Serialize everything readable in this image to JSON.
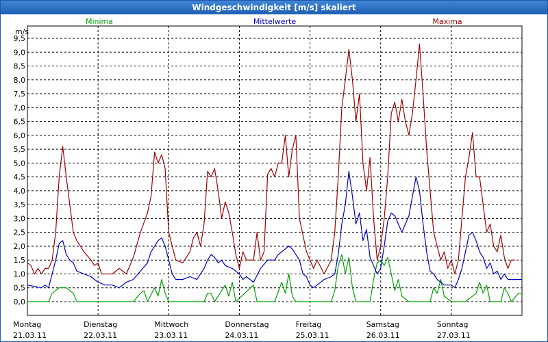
{
  "window": {
    "title": "Windgeschwindigkeit [m/s] skaliert"
  },
  "colors": {
    "minima": "#00a000",
    "mittel": "#0000c0",
    "maxima": "#a00000",
    "grid": "#000000"
  },
  "chart_data": {
    "type": "line",
    "title": "Windgeschwindigkeit [m/s] skaliert",
    "ylabel": "m/s",
    "xlabel": "",
    "ylim": [
      0,
      9.5
    ],
    "yticks": [
      "0,0",
      "0,5",
      "1,0",
      "1,5",
      "2,0",
      "2,5",
      "3,0",
      "3,5",
      "4,0",
      "4,5",
      "5,0",
      "5,5",
      "6,0",
      "6,5",
      "7,0",
      "7,5",
      "8,0",
      "8,5",
      "9,0",
      "9,5"
    ],
    "xticks": [
      {
        "day": "Montag",
        "date": "21.03.11"
      },
      {
        "day": "Dienstag",
        "date": "22.03.11"
      },
      {
        "day": "Mittwoch",
        "date": "23.03.11"
      },
      {
        "day": "Donnerstag",
        "date": "24.03.11"
      },
      {
        "day": "Freitag",
        "date": "25.03.11"
      },
      {
        "day": "Samstag",
        "date": "26.03.11"
      },
      {
        "day": "Sonntag",
        "date": "27.03.11"
      }
    ],
    "x_unit": "days since Montag 21.03.11 00:00",
    "x_range": [
      0,
      7
    ],
    "grid": true,
    "series": [
      {
        "name": "Minima",
        "color": "#00a000",
        "points": [
          [
            0,
            0
          ],
          [
            0.3,
            0
          ],
          [
            0.35,
            0.3
          ],
          [
            0.45,
            0.5
          ],
          [
            0.55,
            0.5
          ],
          [
            0.65,
            0.3
          ],
          [
            0.7,
            0
          ],
          [
            1.0,
            0
          ],
          [
            1.2,
            0
          ],
          [
            1.5,
            0
          ],
          [
            1.6,
            0.3
          ],
          [
            1.65,
            0.4
          ],
          [
            1.7,
            0
          ],
          [
            1.8,
            0.5
          ],
          [
            1.85,
            0.2
          ],
          [
            1.9,
            0.8
          ],
          [
            1.95,
            0.3
          ],
          [
            2.0,
            0
          ],
          [
            2.2,
            0
          ],
          [
            2.5,
            0
          ],
          [
            2.55,
            0.3
          ],
          [
            2.6,
            0.3
          ],
          [
            2.65,
            0
          ],
          [
            2.8,
            0.6
          ],
          [
            2.85,
            0.2
          ],
          [
            2.9,
            0.7
          ],
          [
            2.95,
            0
          ],
          [
            3.2,
            0.6
          ],
          [
            3.25,
            0
          ],
          [
            3.5,
            0
          ],
          [
            3.6,
            0.7
          ],
          [
            3.65,
            0.3
          ],
          [
            3.7,
            1.0
          ],
          [
            3.75,
            0.2
          ],
          [
            3.8,
            0
          ],
          [
            4.3,
            0
          ],
          [
            4.35,
            0.4
          ],
          [
            4.4,
            1.3
          ],
          [
            4.45,
            1.7
          ],
          [
            4.5,
            1.0
          ],
          [
            4.55,
            1.6
          ],
          [
            4.6,
            0.5
          ],
          [
            4.65,
            0
          ],
          [
            4.85,
            0
          ],
          [
            4.9,
            0.8
          ],
          [
            4.95,
            1.4
          ],
          [
            5.0,
            1.5
          ],
          [
            5.05,
            1.3
          ],
          [
            5.1,
            1.6
          ],
          [
            5.15,
            1.0
          ],
          [
            5.2,
            0.4
          ],
          [
            5.25,
            0.8
          ],
          [
            5.3,
            0.2
          ],
          [
            5.4,
            0
          ],
          [
            5.7,
            0
          ],
          [
            5.75,
            0.5
          ],
          [
            5.8,
            0.3
          ],
          [
            5.85,
            0.8
          ],
          [
            5.9,
            0.2
          ],
          [
            6.0,
            0
          ],
          [
            6.2,
            0
          ],
          [
            6.35,
            0.3
          ],
          [
            6.4,
            0.7
          ],
          [
            6.45,
            0.3
          ],
          [
            6.5,
            0.6
          ],
          [
            6.55,
            0
          ],
          [
            6.7,
            0
          ],
          [
            6.75,
            0.5
          ],
          [
            6.8,
            0.3
          ],
          [
            6.85,
            0
          ],
          [
            6.95,
            0.3
          ],
          [
            7.0,
            0.3
          ]
        ]
      },
      {
        "name": "Mittelwerte",
        "color": "#0000c0",
        "points": [
          [
            0,
            0.6
          ],
          [
            0.1,
            0.55
          ],
          [
            0.2,
            0.5
          ],
          [
            0.25,
            0.6
          ],
          [
            0.3,
            0.5
          ],
          [
            0.35,
            1.0
          ],
          [
            0.4,
            1.5
          ],
          [
            0.45,
            2.1
          ],
          [
            0.5,
            2.2
          ],
          [
            0.55,
            1.7
          ],
          [
            0.6,
            1.5
          ],
          [
            0.65,
            1.4
          ],
          [
            0.7,
            1.1
          ],
          [
            0.8,
            1.0
          ],
          [
            0.9,
            0.9
          ],
          [
            1.0,
            0.7
          ],
          [
            1.1,
            0.6
          ],
          [
            1.2,
            0.6
          ],
          [
            1.3,
            0.5
          ],
          [
            1.4,
            0.7
          ],
          [
            1.5,
            0.8
          ],
          [
            1.6,
            1.1
          ],
          [
            1.7,
            1.4
          ],
          [
            1.75,
            1.8
          ],
          [
            1.8,
            2.0
          ],
          [
            1.85,
            2.2
          ],
          [
            1.9,
            2.3
          ],
          [
            1.95,
            2.0
          ],
          [
            2.0,
            1.5
          ],
          [
            2.05,
            1.0
          ],
          [
            2.1,
            0.8
          ],
          [
            2.2,
            0.8
          ],
          [
            2.3,
            0.9
          ],
          [
            2.4,
            0.8
          ],
          [
            2.45,
            1.0
          ],
          [
            2.5,
            1.2
          ],
          [
            2.55,
            1.5
          ],
          [
            2.6,
            1.7
          ],
          [
            2.65,
            1.6
          ],
          [
            2.7,
            1.4
          ],
          [
            2.75,
            1.5
          ],
          [
            2.8,
            1.3
          ],
          [
            2.9,
            1.2
          ],
          [
            3.0,
            1.0
          ],
          [
            3.05,
            0.8
          ],
          [
            3.1,
            0.9
          ],
          [
            3.2,
            0.7
          ],
          [
            3.3,
            1.2
          ],
          [
            3.4,
            1.5
          ],
          [
            3.5,
            1.5
          ],
          [
            3.55,
            1.7
          ],
          [
            3.6,
            1.8
          ],
          [
            3.65,
            1.9
          ],
          [
            3.7,
            2.0
          ],
          [
            3.75,
            1.9
          ],
          [
            3.8,
            1.7
          ],
          [
            3.85,
            1.5
          ],
          [
            3.9,
            1.0
          ],
          [
            3.95,
            0.9
          ],
          [
            4.0,
            0.6
          ],
          [
            4.05,
            0.5
          ],
          [
            4.1,
            0.6
          ],
          [
            4.2,
            0.8
          ],
          [
            4.3,
            0.9
          ],
          [
            4.35,
            1.0
          ],
          [
            4.4,
            1.7
          ],
          [
            4.45,
            2.8
          ],
          [
            4.5,
            3.5
          ],
          [
            4.55,
            4.7
          ],
          [
            4.6,
            3.8
          ],
          [
            4.65,
            2.8
          ],
          [
            4.7,
            3.2
          ],
          [
            4.75,
            2.2
          ],
          [
            4.8,
            2.6
          ],
          [
            4.85,
            1.6
          ],
          [
            4.9,
            1.3
          ],
          [
            4.95,
            1.0
          ],
          [
            5.0,
            1.2
          ],
          [
            5.05,
            2.0
          ],
          [
            5.1,
            2.9
          ],
          [
            5.15,
            3.2
          ],
          [
            5.2,
            3.1
          ],
          [
            5.25,
            2.8
          ],
          [
            5.3,
            2.5
          ],
          [
            5.35,
            2.8
          ],
          [
            5.4,
            3.1
          ],
          [
            5.45,
            3.8
          ],
          [
            5.5,
            4.5
          ],
          [
            5.55,
            4.0
          ],
          [
            5.6,
            2.8
          ],
          [
            5.65,
            1.8
          ],
          [
            5.7,
            1.1
          ],
          [
            5.75,
            1.0
          ],
          [
            5.8,
            0.8
          ],
          [
            5.85,
            0.7
          ],
          [
            5.9,
            0.6
          ],
          [
            6.0,
            0.6
          ],
          [
            6.05,
            0.5
          ],
          [
            6.1,
            0.8
          ],
          [
            6.15,
            1.2
          ],
          [
            6.2,
            1.8
          ],
          [
            6.25,
            2.4
          ],
          [
            6.3,
            2.5
          ],
          [
            6.35,
            2.2
          ],
          [
            6.4,
            1.8
          ],
          [
            6.45,
            1.6
          ],
          [
            6.5,
            1.2
          ],
          [
            6.55,
            1.4
          ],
          [
            6.6,
            1.0
          ],
          [
            6.65,
            1.1
          ],
          [
            6.7,
            0.8
          ],
          [
            6.75,
            1.0
          ],
          [
            6.8,
            0.8
          ],
          [
            6.9,
            0.8
          ],
          [
            7.0,
            0.8
          ]
        ]
      },
      {
        "name": "Maxima",
        "color": "#a00000",
        "points": [
          [
            0,
            1.4
          ],
          [
            0.05,
            1.3
          ],
          [
            0.1,
            1.0
          ],
          [
            0.15,
            1.2
          ],
          [
            0.2,
            1.0
          ],
          [
            0.25,
            1.2
          ],
          [
            0.3,
            1.2
          ],
          [
            0.35,
            1.5
          ],
          [
            0.4,
            2.5
          ],
          [
            0.45,
            4.5
          ],
          [
            0.5,
            5.6
          ],
          [
            0.55,
            4.5
          ],
          [
            0.6,
            3.5
          ],
          [
            0.65,
            2.5
          ],
          [
            0.7,
            2.2
          ],
          [
            0.8,
            1.8
          ],
          [
            0.9,
            1.5
          ],
          [
            0.95,
            1.3
          ],
          [
            1.0,
            1.4
          ],
          [
            1.05,
            1.0
          ],
          [
            1.1,
            1.0
          ],
          [
            1.2,
            1.0
          ],
          [
            1.3,
            1.2
          ],
          [
            1.4,
            1.0
          ],
          [
            1.5,
            1.6
          ],
          [
            1.6,
            2.5
          ],
          [
            1.7,
            3.2
          ],
          [
            1.75,
            3.8
          ],
          [
            1.8,
            5.4
          ],
          [
            1.85,
            5.0
          ],
          [
            1.9,
            5.3
          ],
          [
            1.95,
            4.8
          ],
          [
            2.0,
            2.5
          ],
          [
            2.05,
            2.0
          ],
          [
            2.1,
            1.5
          ],
          [
            2.2,
            1.4
          ],
          [
            2.3,
            1.8
          ],
          [
            2.35,
            2.3
          ],
          [
            2.4,
            2.5
          ],
          [
            2.45,
            2.0
          ],
          [
            2.5,
            2.8
          ],
          [
            2.55,
            4.7
          ],
          [
            2.6,
            4.5
          ],
          [
            2.65,
            4.8
          ],
          [
            2.7,
            4.0
          ],
          [
            2.75,
            3.0
          ],
          [
            2.8,
            3.6
          ],
          [
            2.85,
            3.2
          ],
          [
            2.9,
            2.5
          ],
          [
            2.95,
            1.7
          ],
          [
            3.0,
            1.2
          ],
          [
            3.05,
            1.8
          ],
          [
            3.1,
            1.5
          ],
          [
            3.2,
            1.5
          ],
          [
            3.25,
            2.5
          ],
          [
            3.3,
            1.5
          ],
          [
            3.35,
            1.8
          ],
          [
            3.4,
            4.6
          ],
          [
            3.45,
            4.8
          ],
          [
            3.5,
            4.5
          ],
          [
            3.55,
            5.0
          ],
          [
            3.6,
            5.0
          ],
          [
            3.65,
            6.0
          ],
          [
            3.7,
            4.5
          ],
          [
            3.75,
            5.5
          ],
          [
            3.8,
            6.0
          ],
          [
            3.85,
            3.0
          ],
          [
            3.9,
            2.4
          ],
          [
            3.95,
            1.8
          ],
          [
            4.0,
            1.5
          ],
          [
            4.05,
            1.2
          ],
          [
            4.1,
            1.5
          ],
          [
            4.2,
            1.0
          ],
          [
            4.3,
            1.5
          ],
          [
            4.35,
            2.5
          ],
          [
            4.4,
            4.5
          ],
          [
            4.45,
            7.0
          ],
          [
            4.5,
            8.0
          ],
          [
            4.55,
            9.1
          ],
          [
            4.6,
            8.0
          ],
          [
            4.65,
            6.5
          ],
          [
            4.7,
            7.5
          ],
          [
            4.75,
            5.0
          ],
          [
            4.8,
            4.0
          ],
          [
            4.85,
            5.2
          ],
          [
            4.9,
            3.0
          ],
          [
            4.95,
            1.5
          ],
          [
            5.0,
            2.0
          ],
          [
            5.05,
            3.0
          ],
          [
            5.1,
            4.5
          ],
          [
            5.15,
            6.8
          ],
          [
            5.2,
            7.2
          ],
          [
            5.25,
            6.5
          ],
          [
            5.3,
            7.3
          ],
          [
            5.35,
            6.5
          ],
          [
            5.4,
            6.0
          ],
          [
            5.45,
            6.8
          ],
          [
            5.5,
            8.0
          ],
          [
            5.55,
            9.3
          ],
          [
            5.6,
            7.5
          ],
          [
            5.65,
            5.5
          ],
          [
            5.7,
            4.0
          ],
          [
            5.75,
            2.5
          ],
          [
            5.8,
            2.0
          ],
          [
            5.85,
            1.5
          ],
          [
            5.9,
            1.8
          ],
          [
            5.95,
            1.2
          ],
          [
            6.0,
            1.5
          ],
          [
            6.05,
            1.0
          ],
          [
            6.1,
            1.5
          ],
          [
            6.15,
            3.0
          ],
          [
            6.2,
            4.5
          ],
          [
            6.25,
            5.2
          ],
          [
            6.3,
            6.1
          ],
          [
            6.35,
            4.5
          ],
          [
            6.4,
            4.5
          ],
          [
            6.45,
            3.5
          ],
          [
            6.5,
            2.5
          ],
          [
            6.55,
            2.8
          ],
          [
            6.6,
            2.0
          ],
          [
            6.65,
            1.8
          ],
          [
            6.7,
            2.4
          ],
          [
            6.75,
            1.6
          ],
          [
            6.8,
            1.2
          ],
          [
            6.85,
            1.5
          ],
          [
            6.9,
            1.5
          ]
        ]
      }
    ]
  }
}
